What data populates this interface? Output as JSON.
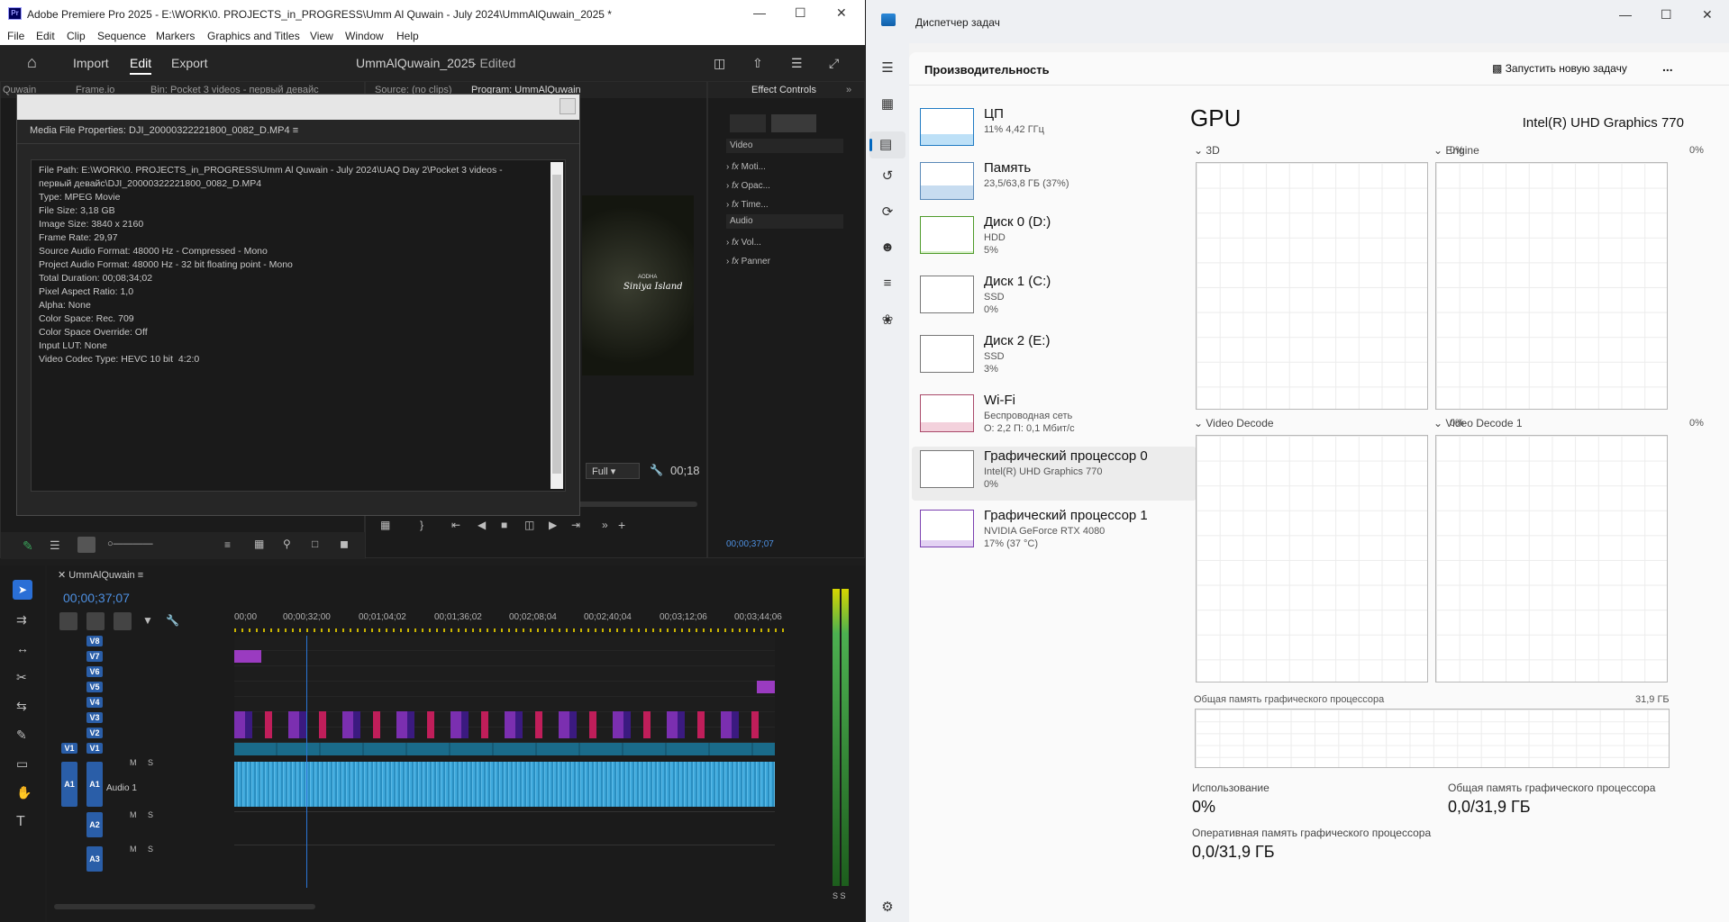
{
  "premiere": {
    "window_title": "Adobe Premiere Pro 2025 - E:\\WORK\\0. PROJECTS_in_PROGRESS\\Umm Al Quwain - July 2024\\UmmAlQuwain_2025 *",
    "logo": "Pr",
    "menu": [
      "File",
      "Edit",
      "Clip",
      "Sequence",
      "Markers",
      "Graphics and Titles",
      "View",
      "Window",
      "Help"
    ],
    "header": {
      "import": "Import",
      "edit": "Edit",
      "export": "Export",
      "project": "UmmAlQuwain_2025",
      "status": "- Edited"
    },
    "tabs_left": [
      "Quwain",
      "Frame.io",
      "Bin: Pocket 3 videos - первый девайс"
    ],
    "tabs_mid": [
      "Source: (no clips)",
      "Program: UmmAlQuwain"
    ],
    "effect_controls": {
      "tab": "Effect Controls",
      "video_label": "Video",
      "audio_label": "Audio",
      "video_items": [
        "Moti...",
        "Opac...",
        "Time..."
      ],
      "audio_items": [
        "Vol...",
        "Panner"
      ],
      "timecode": "00;00;37;07"
    },
    "program": {
      "resolution": "Full",
      "timecode": "00;18",
      "overlay_line1": "AODHA",
      "overlay_line2": "Siniya Island"
    },
    "dialog": {
      "title": "Media File Properties: DJI_20000322221800_0082_D.MP4",
      "lines": [
        "File Path: E:\\WORK\\0. PROJECTS_in_PROGRESS\\Umm Al Quwain - July 2024\\UAQ Day 2\\Pocket 3 videos -",
        "первый девайс\\DJI_20000322221800_0082_D.MP4",
        "Type: MPEG Movie",
        "File Size: 3,18 GB",
        "Image Size: 3840 x 2160",
        "Frame Rate: 29,97",
        "Source Audio Format: 48000 Hz - Compressed - Mono",
        "Project Audio Format: 48000 Hz - 32 bit floating point - Mono",
        "Total Duration: 00;08;34;02",
        "Pixel Aspect Ratio: 1,0",
        "Alpha: None",
        "Color Space: Rec. 709",
        "Color Space Override: Off",
        "Input LUT: None",
        "Video Codec Type: HEVC 10 bit  4:2:0"
      ]
    },
    "timeline": {
      "sequence": "UmmAlQuwain",
      "timecode": "00;00;37;07",
      "ruler": [
        "00;00",
        "00;00;32;00",
        "00;01;04;02",
        "00;01;36;02",
        "00;02;08;04",
        "00;02;40;04",
        "00;03;12;06",
        "00;03;44;06"
      ],
      "video_tracks": [
        "V8",
        "V7",
        "V6",
        "V5",
        "V4",
        "V3",
        "V2",
        "V1"
      ],
      "v1_source": "V1",
      "audio_tracks": [
        "A1",
        "A2",
        "A3"
      ],
      "a1_source": "A1",
      "audio1_name": "Audio 1",
      "mute": "M",
      "solo": "S",
      "meter_labels": "S S"
    }
  },
  "taskmgr": {
    "title": "Диспетчер задач",
    "page": "Производительность",
    "new_task": "Запустить новую задачу",
    "more": "...",
    "items": [
      {
        "name": "ЦП",
        "s1": "11% 4,42 ГГц",
        "s2": ""
      },
      {
        "name": "Память",
        "s1": "23,5/63,8 ГБ (37%)",
        "s2": ""
      },
      {
        "name": "Диск 0 (D:)",
        "s1": "HDD",
        "s2": "5%"
      },
      {
        "name": "Диск 1 (C:)",
        "s1": "SSD",
        "s2": "0%"
      },
      {
        "name": "Диск 2 (E:)",
        "s1": "SSD",
        "s2": "3%"
      },
      {
        "name": "Wi-Fi",
        "s1": "Беспроводная сеть",
        "s2": "О: 2,2 П: 0,1 Мбит/с"
      },
      {
        "name": "Графический процессор 0",
        "s1": "Intel(R) UHD Graphics 770",
        "s2": "0%"
      },
      {
        "name": "Графический процессор 1",
        "s1": "NVIDIA GeForce RTX 4080",
        "s2": "17% (37 °C)"
      }
    ],
    "gpu": {
      "title": "GPU",
      "device": "Intel(R) UHD Graphics 770",
      "graphs": [
        {
          "label": "3D",
          "value": "0%"
        },
        {
          "label": "Engine",
          "value": "0%"
        },
        {
          "label": "Video Decode",
          "value": "0%"
        },
        {
          "label": "Video Decode 1",
          "value": "0%"
        }
      ],
      "shared_label": "Общая память графического процессора",
      "shared_max": "31,9 ГБ",
      "stats": [
        {
          "label": "Использование",
          "value": "0%"
        },
        {
          "label": "Общая память графического процессора",
          "value": "0,0/31,9 ГБ"
        },
        {
          "label": "Оперативная память графического процессора",
          "value": "0,0/31,9 ГБ"
        }
      ]
    }
  }
}
